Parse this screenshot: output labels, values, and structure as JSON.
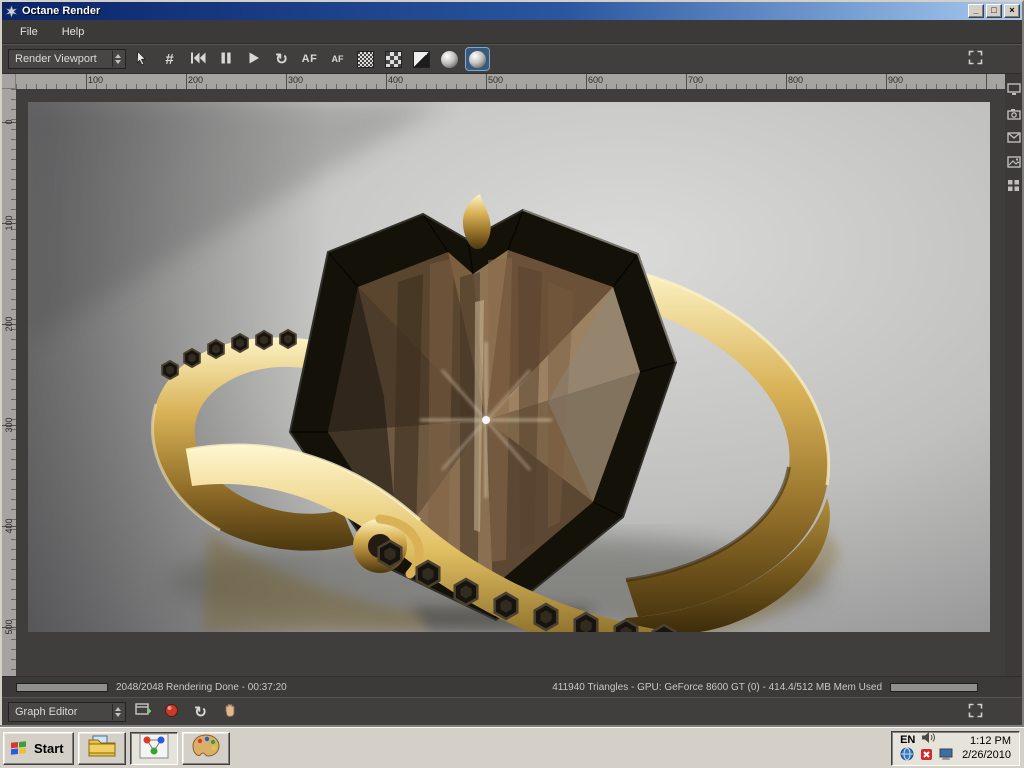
{
  "window": {
    "title": "Octane Render",
    "minimize_glyph": "_",
    "maximize_glyph": "□",
    "close_glyph": "×"
  },
  "menubar": {
    "file": "File",
    "help": "Help"
  },
  "toolbar": {
    "viewport_dropdown": "Render Viewport",
    "focus_glyph": "#",
    "refresh_glyph": "↻",
    "af_label": "AF",
    "af_small_label": "AF"
  },
  "rulers": {
    "h": [
      "100",
      "200",
      "300",
      "400",
      "500",
      "600",
      "700",
      "800",
      "900"
    ],
    "v": [
      "0",
      "100",
      "200",
      "300",
      "400",
      "500"
    ]
  },
  "statusbar": {
    "render_status": "2048/2048 Rendering Done - 00:37:20",
    "gpu_status": "411940 Triangles - GPU: GeForce 8600 GT (0) - 414.4/512 MB Mem Used"
  },
  "graph_editor": {
    "dropdown": "Graph Editor",
    "refresh_glyph": "↻"
  },
  "taskbar": {
    "start_label": "Start",
    "tray": {
      "language": "EN",
      "time": "1:12 PM",
      "date": "2/26/2010"
    }
  },
  "colors": {
    "titlebar_start": "#0a246a",
    "titlebar_end": "#a6caf0",
    "panel_dark": "#3b3a39",
    "taskbar": "#d4d0c8",
    "selection": "#7aa8d8",
    "gold": "#d9b257"
  }
}
